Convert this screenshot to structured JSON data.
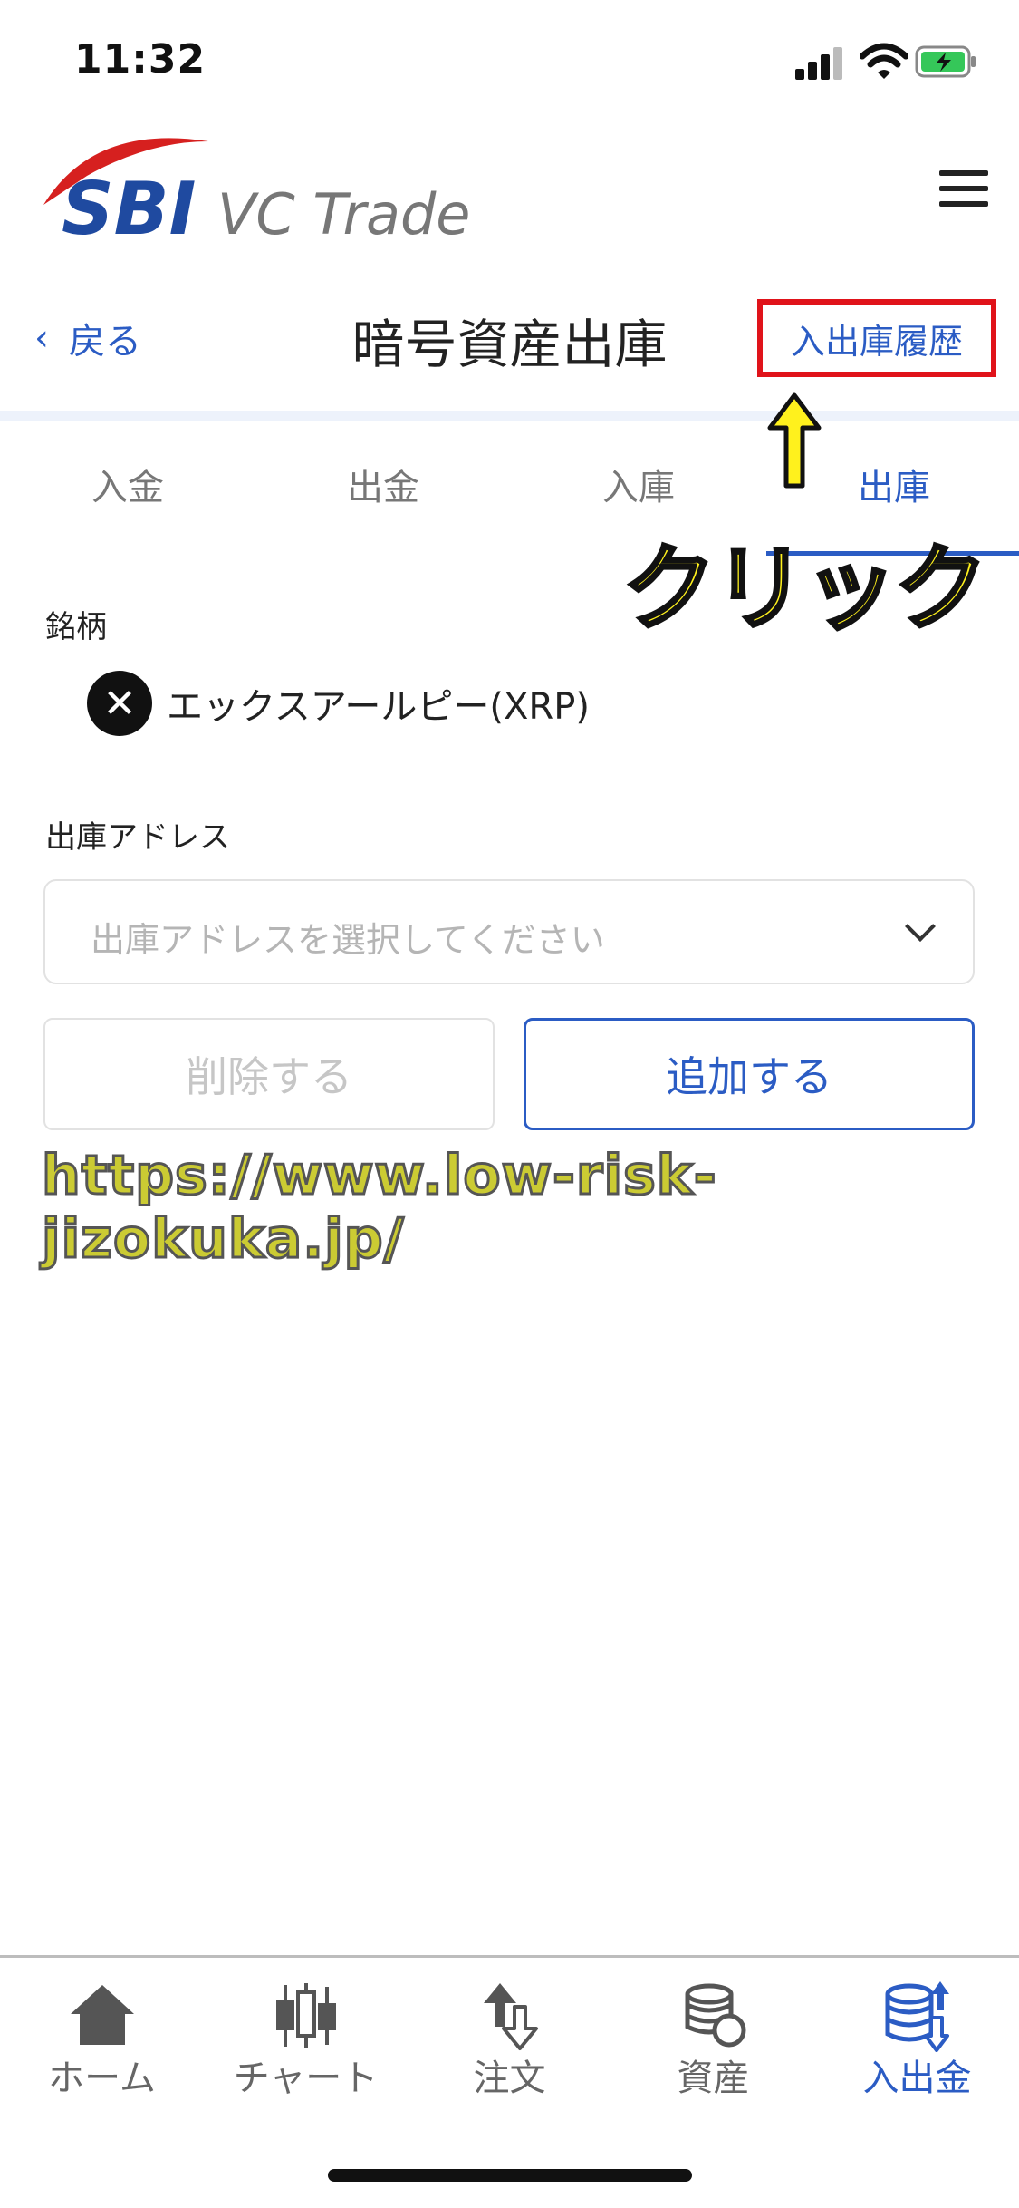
{
  "status_bar": {
    "time": "11:32"
  },
  "header": {
    "logo_sbi": "SBI",
    "logo_product": "VC Trade",
    "back_label": "戻る",
    "title": "暗号資産出庫",
    "history_link": "入出庫履歴"
  },
  "tabs": [
    {
      "label": "入金",
      "active": false
    },
    {
      "label": "出金",
      "active": false
    },
    {
      "label": "入庫",
      "active": false
    },
    {
      "label": "出庫",
      "active": true
    }
  ],
  "annotation": {
    "arrow": "↑",
    "text": "クリック",
    "highlight_color": "#e0131a"
  },
  "symbol": {
    "label": "銘柄",
    "coin_icon": "xrp-icon",
    "coin_name": "エックスアールピー(XRP)"
  },
  "address": {
    "label": "出庫アドレス",
    "placeholder": "出庫アドレスを選択してください"
  },
  "buttons": {
    "delete": "削除する",
    "add": "追加する"
  },
  "watermark": "https://www.low-risk-jizokuka.jp/",
  "bottom_nav": [
    {
      "label": "ホーム",
      "icon": "home-icon",
      "active": false
    },
    {
      "label": "チャート",
      "icon": "chart-icon",
      "active": false
    },
    {
      "label": "注文",
      "icon": "order-icon",
      "active": false
    },
    {
      "label": "資産",
      "icon": "assets-icon",
      "active": false
    },
    {
      "label": "入出金",
      "icon": "deposit-withdraw-icon",
      "active": true
    }
  ],
  "colors": {
    "accent": "#2b5cc4",
    "text": "#222222",
    "muted": "#777777"
  }
}
